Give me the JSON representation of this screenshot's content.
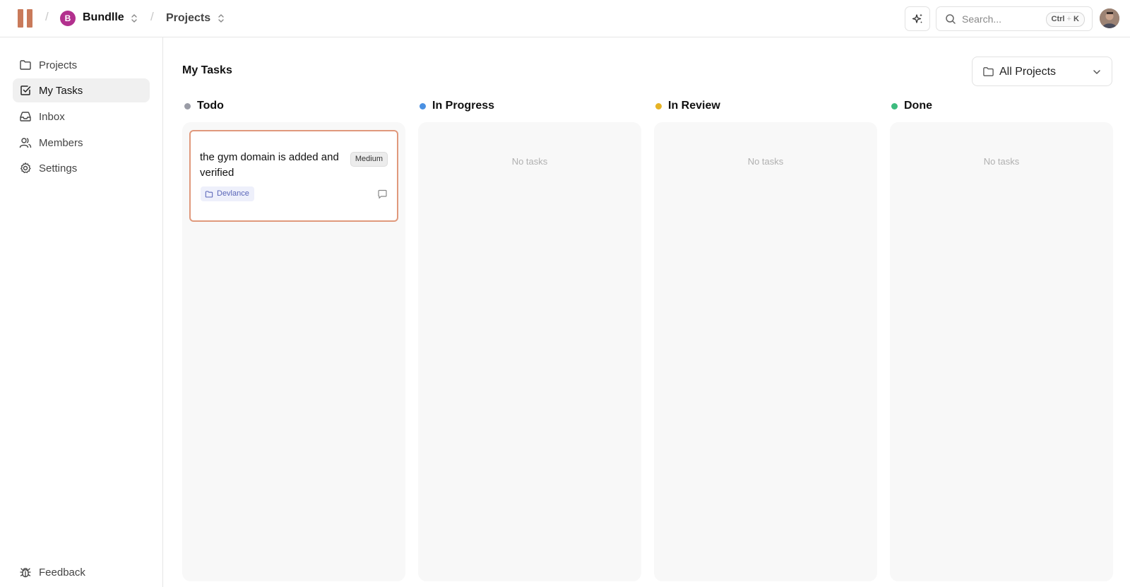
{
  "header": {
    "workspace_initial": "B",
    "workspace_name": "Bundlle",
    "breadcrumb": "Projects",
    "search_placeholder": "Search...",
    "search_shortcut_ctrl": "Ctrl",
    "search_shortcut_plus": "+",
    "search_shortcut_key": "K"
  },
  "sidebar": {
    "items": [
      {
        "label": "Projects",
        "icon": "folder-icon"
      },
      {
        "label": "My Tasks",
        "icon": "checkbox-icon",
        "active": true
      },
      {
        "label": "Inbox",
        "icon": "inbox-icon"
      },
      {
        "label": "Members",
        "icon": "users-icon"
      },
      {
        "label": "Settings",
        "icon": "gear-icon"
      }
    ],
    "feedback_label": "Feedback"
  },
  "main": {
    "title": "My Tasks",
    "project_filter": "All Projects",
    "columns": [
      {
        "name": "Todo",
        "color": "#9a9ca6"
      },
      {
        "name": "In Progress",
        "color": "#4a90e2"
      },
      {
        "name": "In Review",
        "color": "#e6b325"
      },
      {
        "name": "Done",
        "color": "#3dbb7e"
      }
    ],
    "empty_text": "No tasks",
    "card": {
      "title": "the gym domain is added and verified",
      "priority": "Medium",
      "project": "Devlance"
    }
  },
  "colors": {
    "accent_logo": "#c97a5a",
    "workspace_avatar": "#b2308e",
    "card_border": "#e0997c"
  }
}
